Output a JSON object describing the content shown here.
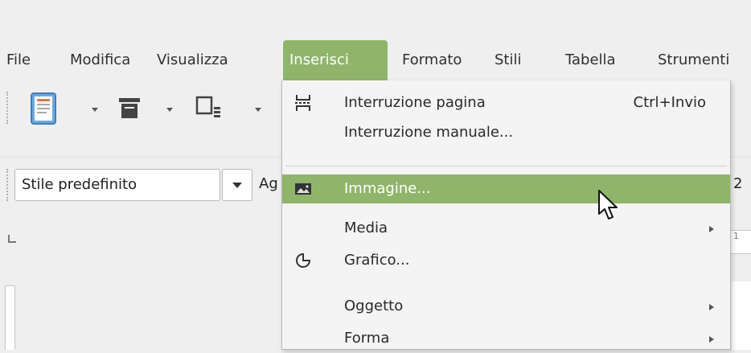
{
  "menubar": {
    "items": [
      {
        "label": "File"
      },
      {
        "label": "Modifica"
      },
      {
        "label": "Visualizza"
      },
      {
        "label": "Inserisci"
      },
      {
        "label": "Formato"
      },
      {
        "label": "Stili"
      },
      {
        "label": "Tabella"
      },
      {
        "label": "Strumenti"
      }
    ],
    "open_item": "Inserisci"
  },
  "toolbar": {
    "paragraph_style": "Stile predefinito",
    "font_name_peek": "Ag",
    "font_size_peek": "2",
    "ruler_peek": "1"
  },
  "insert_menu": {
    "items": [
      {
        "label": "Interruzione pagina",
        "shortcut": "Ctrl+Invio",
        "icon": "page-break-icon"
      },
      {
        "label": "Interruzione manuale...",
        "icon": ""
      },
      {
        "label": "Immagine...",
        "icon": "image-icon",
        "highlighted": true
      },
      {
        "label": "Media",
        "icon": "",
        "submenu": true
      },
      {
        "label": "Grafico...",
        "icon": "chart-icon"
      },
      {
        "label": "Oggetto",
        "icon": "",
        "submenu": true
      },
      {
        "label": "Forma",
        "icon": "",
        "submenu": true
      }
    ]
  },
  "colors": {
    "accent": "#8fb56a",
    "background": "#efefef",
    "menu_background": "#f4f4f4"
  }
}
